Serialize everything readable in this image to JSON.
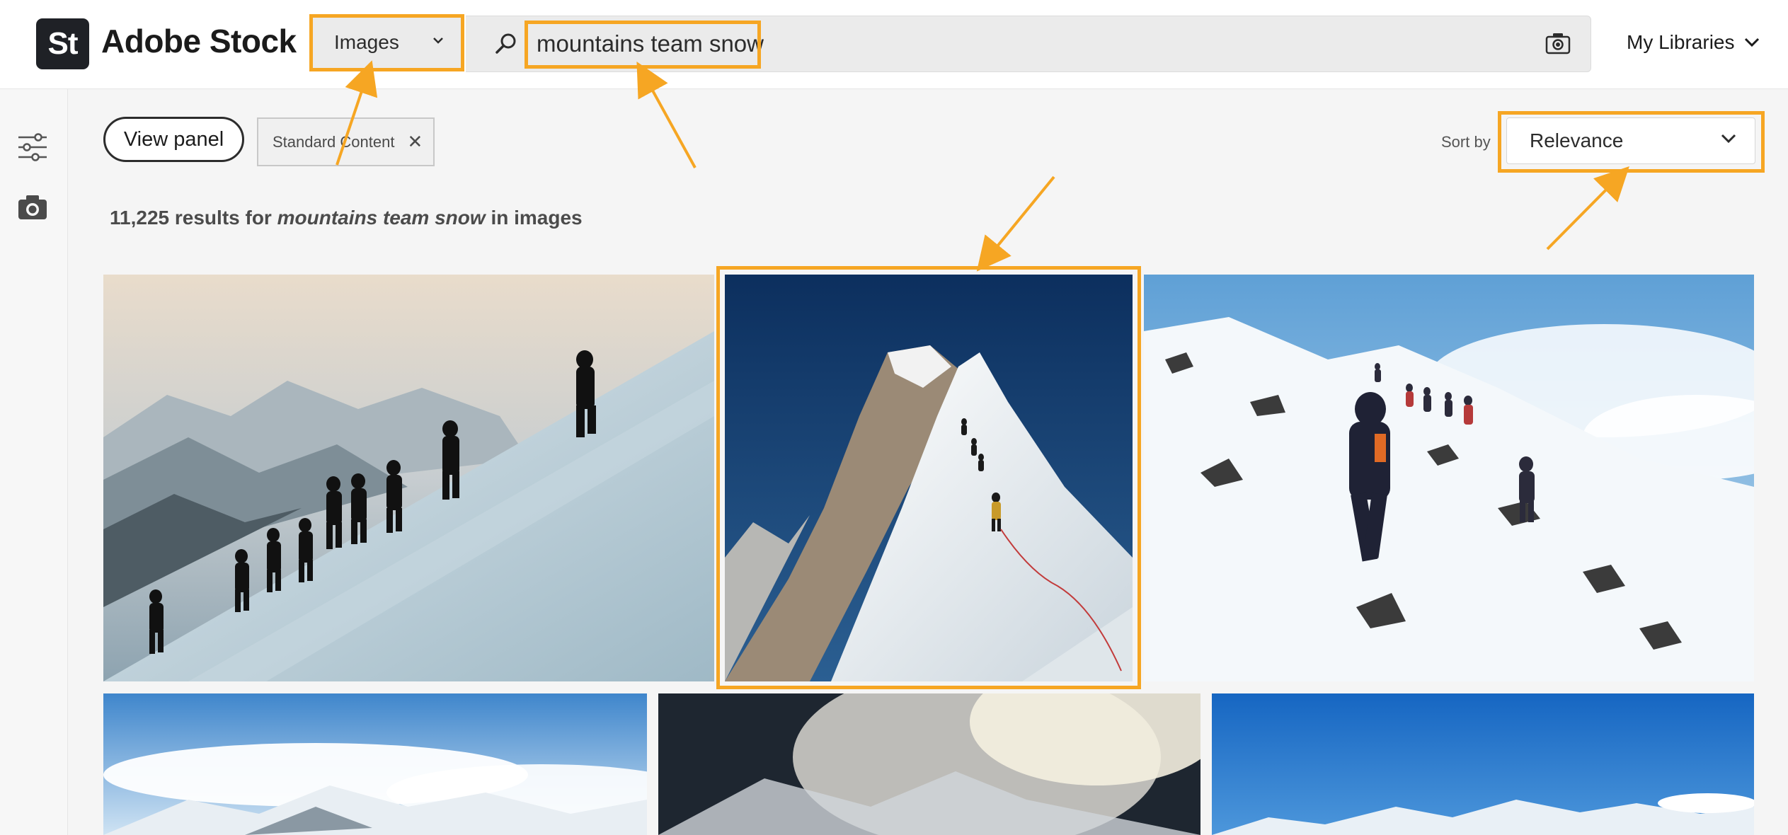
{
  "header": {
    "logo_badge": "St",
    "logo_text": "Adobe Stock",
    "type_selected": "Images",
    "search_value": "mountains team snow",
    "libraries_label": "My Libraries"
  },
  "toolbar": {
    "view_panel_label": "View panel",
    "filter_chip_label": "Standard Content",
    "filter_chip_close": "✕",
    "sort_label": "Sort by",
    "sort_selected": "Relevance"
  },
  "results": {
    "count": "11,225",
    "prefix": "results for",
    "query": "mountains team snow",
    "suffix": "in images"
  },
  "images": [
    {
      "subject": "silhouetted climbers on snowy slope at sunrise"
    },
    {
      "subject": "climbers on snowy mountain ridge under blue sky"
    },
    {
      "subject": "hikers ascending snow covered rocky slope"
    },
    {
      "subject": "snowy mountain range panorama"
    },
    {
      "subject": "climber in misty snow clouds"
    },
    {
      "subject": "snow peaks under deep blue sky"
    }
  ],
  "colors": {
    "highlight": "#f6a623",
    "header_bg": "#ffffff",
    "page_bg": "#f5f5f5",
    "logo_bg": "#1f2126"
  },
  "icons": {
    "search": "search-icon",
    "camera": "camera-icon",
    "filter": "filter-sliders-icon",
    "chevron": "chevron-down-icon",
    "close": "close-icon"
  }
}
